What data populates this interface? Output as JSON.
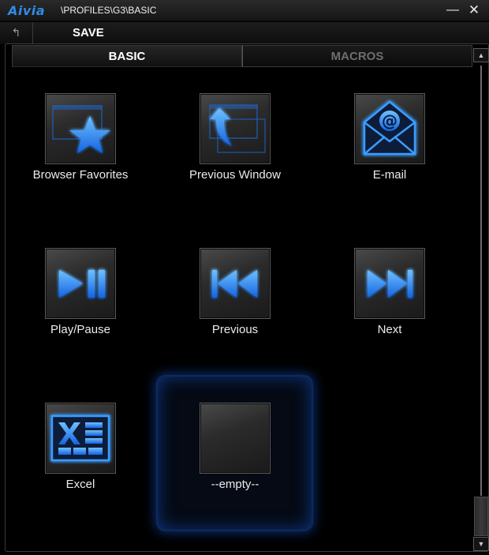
{
  "window": {
    "logo": "Aivia",
    "path": "\\PROFILES\\G3\\BASIC",
    "minimize": "—",
    "close": "✕"
  },
  "toolbar": {
    "back_icon": "↰",
    "save_label": "SAVE"
  },
  "tabs": [
    {
      "label": "BASIC",
      "active": true
    },
    {
      "label": "MACROS",
      "active": false
    }
  ],
  "actions": [
    {
      "label": "Browser Favorites",
      "icon": "star-window-icon"
    },
    {
      "label": "Previous Window",
      "icon": "previous-window-icon"
    },
    {
      "label": "E-mail",
      "icon": "email-envelope-icon"
    },
    {
      "label": "Play/Pause",
      "icon": "play-pause-icon"
    },
    {
      "label": "Previous",
      "icon": "previous-track-icon"
    },
    {
      "label": "Next",
      "icon": "next-track-icon"
    },
    {
      "label": "Excel",
      "icon": "excel-icon"
    },
    {
      "label": "--empty--",
      "icon": "empty-slot",
      "selected": true
    }
  ],
  "colors": {
    "accent": "#2f8be8",
    "glow": "#1e90ff"
  },
  "scrollbar": {
    "up": "▲",
    "down": "▼"
  }
}
